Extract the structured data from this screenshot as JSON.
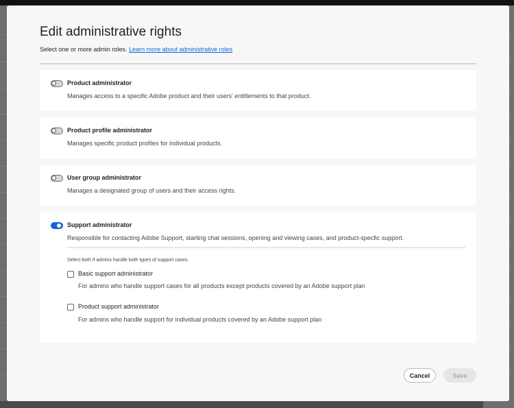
{
  "dialog": {
    "title": "Edit administrative rights",
    "subtitle": "Select one or more admin roles.",
    "learn_more_link": "Learn more about administrative roles"
  },
  "roles": [
    {
      "name": "Product administrator",
      "description": "Manages access to a specific Adobe product and their users' entitlements to that product.",
      "enabled": false
    },
    {
      "name": "Product profile administrator",
      "description": "Manages specific product profiles for individual products.",
      "enabled": false
    },
    {
      "name": "User group administrator",
      "description": "Manages a designated group of users and their access rights.",
      "enabled": false
    },
    {
      "name": "Support administrator",
      "description": "Responsible for contacting Adobe Support, starting chat sessions, opening and viewing cases, and product-specfic support.",
      "enabled": true
    }
  ],
  "support": {
    "hint": "Select both if admins handle both types of support cases.",
    "options": [
      {
        "label": "Basic support administrator",
        "description": "For admins who handle support cases for all products except products covered by an Adobe support plan",
        "checked": false
      },
      {
        "label": "Product support administrator",
        "description": "For admins who handle support for individual products covered by an Adobe support plan",
        "checked": false
      }
    ]
  },
  "footer": {
    "cancel_label": "Cancel",
    "save_label": "Save"
  },
  "colors": {
    "accent": "#1366d6"
  }
}
